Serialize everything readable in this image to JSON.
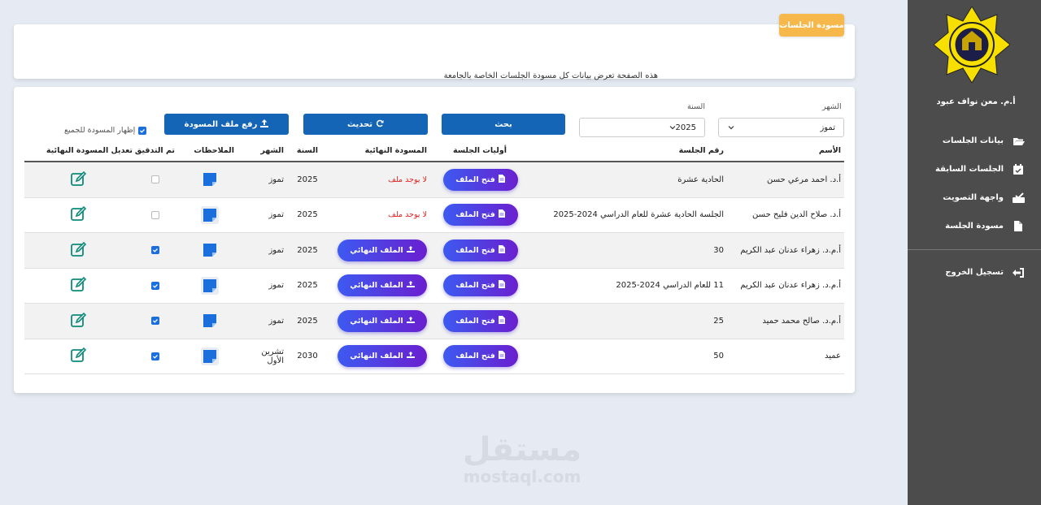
{
  "sidebar": {
    "user_name": "أ.م. معن نواف عبود",
    "items": [
      {
        "label": "بيانات الجلسات",
        "icon": "folder-open-icon"
      },
      {
        "label": "الجلسات السابقة",
        "icon": "calendar-check-icon"
      },
      {
        "label": "واجهة التصويت",
        "icon": "vote-box-icon"
      },
      {
        "label": "مسودة الجلسة",
        "icon": "file-icon"
      }
    ],
    "logout": {
      "label": "تسجيل الخروج",
      "icon": "sign-out-icon"
    }
  },
  "header": {
    "badge": "مسودة الجلسات",
    "description": "هذه الصفحة تعرض بيانات كل مسودة الجلسات الخاصة بالجامعة"
  },
  "filters": {
    "month_label": "الشهر",
    "month_value": "تموز",
    "year_label": "السنة",
    "year_value": "2025",
    "search_label": "بحث",
    "refresh_label": "تحديث",
    "upload_label": "رفع ملف المسودة",
    "show_all_label": "إظهار المسودة للجميع",
    "show_all_checked": true
  },
  "table": {
    "headers": [
      "الأسم",
      "رقم الجلسة",
      "أوليات الجلسة",
      "المسودة النهائية",
      "السنة",
      "الشهر",
      "الملاحظات",
      "تم التدقيق",
      "تعديل المسودة النهائية"
    ],
    "open_file_label": "فتح الملف",
    "final_file_label": "الملف النهائي",
    "no_file_label": "لا يوجد ملف",
    "rows": [
      {
        "name": "أ.د. احمد مرعي حسن",
        "session": "الحادية عشرة",
        "has_final": false,
        "year": "2025",
        "month": "تموز",
        "checked": false
      },
      {
        "name": "أ.د. صلاح الدين فليح حسن",
        "session": "الجلسة الحادية عشرة للعام الدراسي 2024-2025",
        "has_final": false,
        "year": "2025",
        "month": "تموز",
        "checked": false
      },
      {
        "name": "أ.م.د. زهراء عدنان عبد الكريم",
        "session": "30",
        "has_final": true,
        "year": "2025",
        "month": "تموز",
        "checked": true
      },
      {
        "name": "أ.م.د. زهراء عدنان عبد الكريم",
        "session": "11 للعام الدراسي 2024-2025",
        "has_final": true,
        "year": "2025",
        "month": "تموز",
        "checked": true
      },
      {
        "name": "أ.م.د. صالح محمد حميد",
        "session": "25",
        "has_final": true,
        "year": "2025",
        "month": "تموز",
        "checked": true
      },
      {
        "name": "عميد",
        "session": "50",
        "has_final": true,
        "year": "2030",
        "month": "تشرين الأول",
        "checked": true
      }
    ]
  },
  "watermark": {
    "line1": "مستقل",
    "line2": "mostaql.com"
  },
  "colors": {
    "primary": "#1565b7",
    "badge": "#f7b84b",
    "sidebar": "#4c4c4c",
    "danger": "#e02424",
    "pill_start": "#3d5af1",
    "pill_end": "#6a1fcf"
  }
}
